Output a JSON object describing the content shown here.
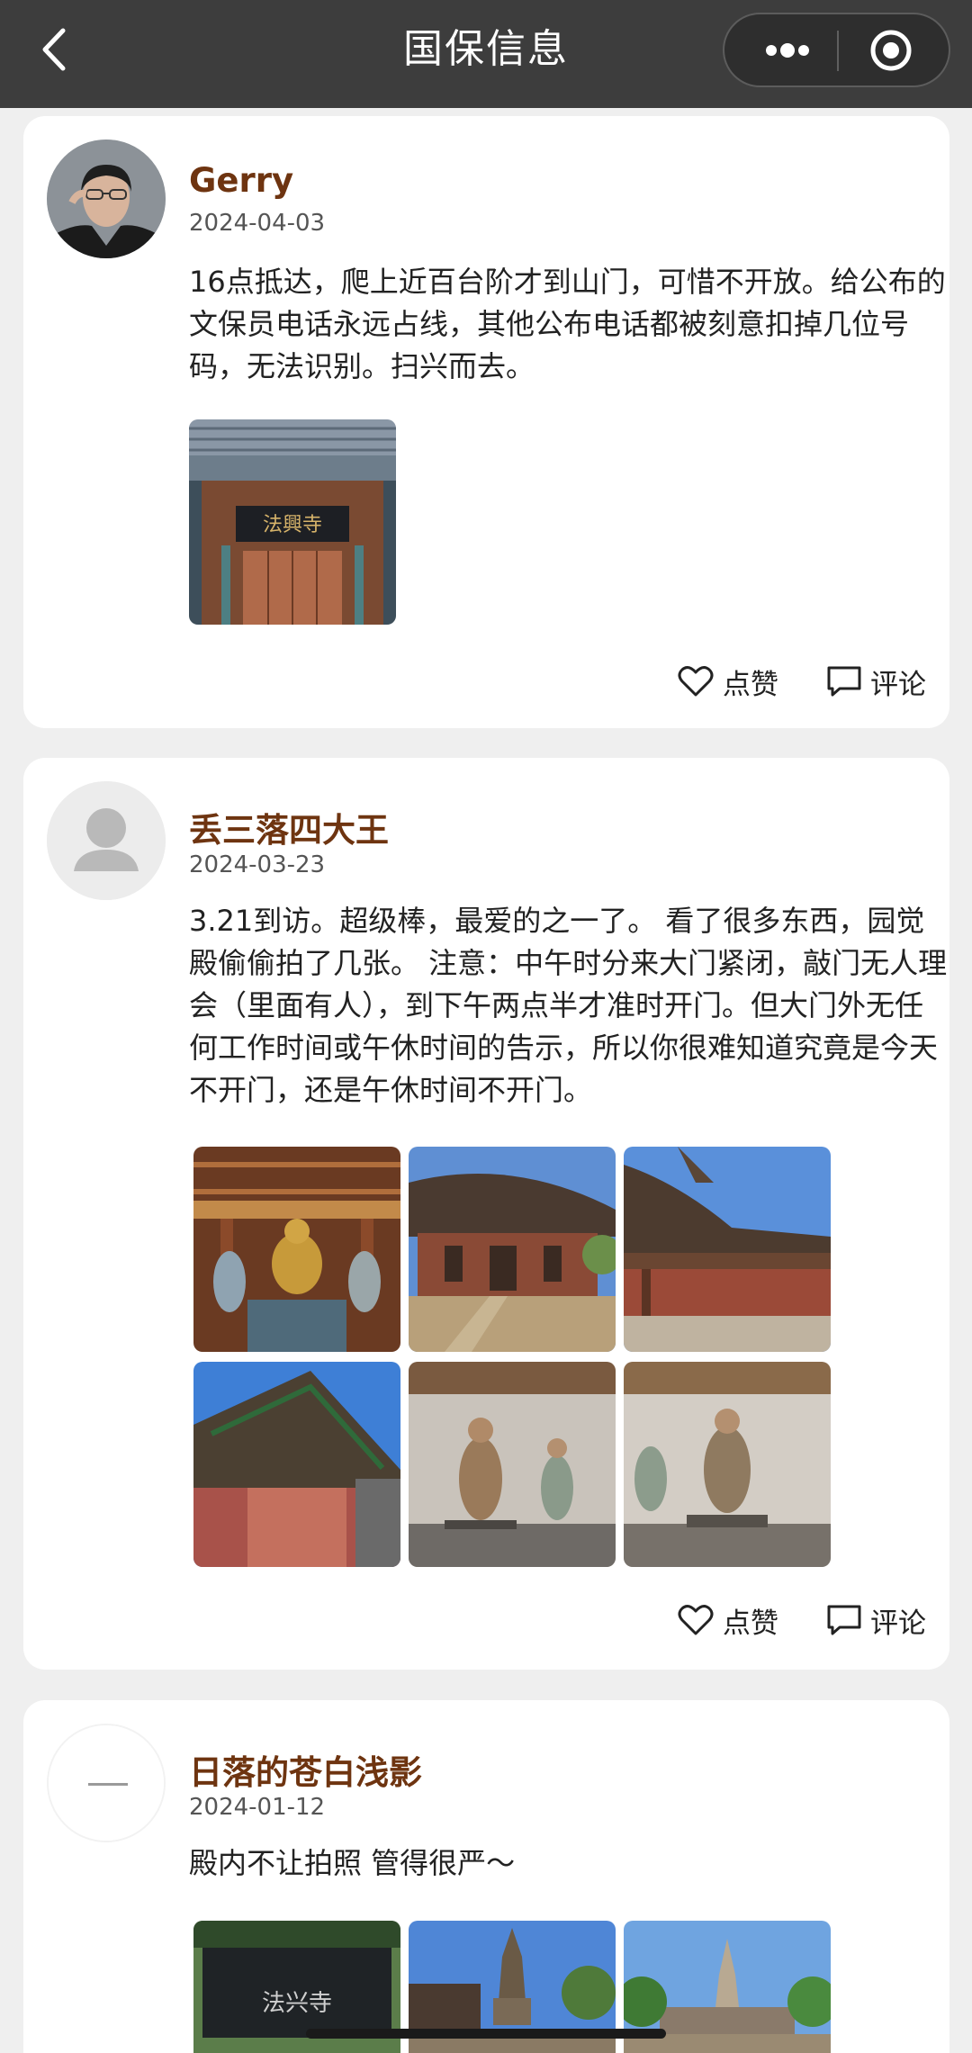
{
  "navbar": {
    "title": "国保信息",
    "back_icon": "chevron-left-icon",
    "more_icon": "more-dots-icon",
    "close_icon": "record-circle-icon"
  },
  "posts": [
    {
      "author": "Gerry",
      "date": "2024-04-03",
      "content": "16点抵达，爬上近百台阶才到山门，可惜不开放。给公布的文保员电话永远占线，其他公布电话都被刻意扣掉几位号码，无法识别。扫兴而去。",
      "photo_count": 1,
      "photo_sign_text": "法興寺"
    },
    {
      "author": "丢三落四大王",
      "date": "2024-03-23",
      "content": "3.21到访。超级棒，最爱的之一了。 看了很多东西，园觉殿偷偷拍了几张。 注意：中午时分来大门紧闭，敲门无人理会（里面有人），到下午两点半才准时开门。但大门外无任何工作时间或午休时间的告示，所以你很难知道究竟是今天不开门，还是午休时间不开门。",
      "photo_count": 6
    },
    {
      "author": "日落的苍白浅影",
      "date": "2024-01-12",
      "content": "殿内不让拍照 管得很严～",
      "photo_count": 3,
      "photo_sign_text": "法兴寺"
    }
  ],
  "actions": {
    "like_label": "点赞",
    "comment_label": "评论",
    "like_icon": "heart-outline-icon",
    "comment_icon": "comment-bubble-icon"
  },
  "colors": {
    "navbar_bg": "#3d3d3d",
    "author_name": "#6e3410",
    "page_bg": "#efefef",
    "card_bg": "#ffffff"
  }
}
